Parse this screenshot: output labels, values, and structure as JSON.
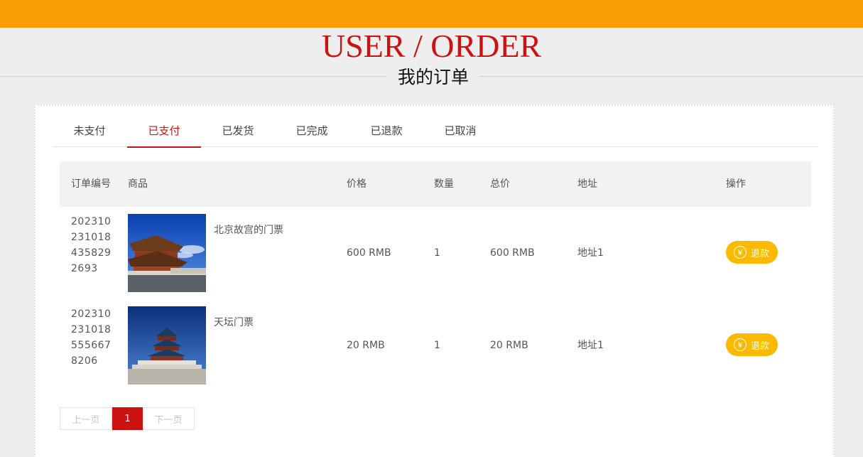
{
  "header": {
    "title_en": "USER / ORDER",
    "title_zh": "我的订单",
    "bar_color": "#fb9e03",
    "title_color": "#cc1111"
  },
  "tabs": [
    {
      "label": "未支付",
      "active": false
    },
    {
      "label": "已支付",
      "active": true
    },
    {
      "label": "已发货",
      "active": false
    },
    {
      "label": "已完成",
      "active": false
    },
    {
      "label": "已退款",
      "active": false
    },
    {
      "label": "已取消",
      "active": false
    }
  ],
  "table": {
    "headers": {
      "order_no": "订单编号",
      "product": "商品",
      "price": "价格",
      "quantity": "数量",
      "total": "总价",
      "address": "地址",
      "action": "操作"
    },
    "rows": [
      {
        "order_no": "2023102310184358292693",
        "product": "北京故宫的门票",
        "image_icon": "forbidden-city-photo",
        "price": "600 RMB",
        "quantity": "1",
        "total": "600 RMB",
        "address": "地址1",
        "action_label": "退款",
        "action_icon": "yen-icon"
      },
      {
        "order_no": "2023102310185556678206",
        "product": "天坛门票",
        "image_icon": "temple-of-heaven-photo",
        "price": "20 RMB",
        "quantity": "1",
        "total": "20 RMB",
        "address": "地址1",
        "action_label": "退款",
        "action_icon": "yen-icon"
      }
    ]
  },
  "pagination": {
    "prev_label": "上一页",
    "current": "1",
    "next_label": "下一页"
  },
  "colors": {
    "accent_red": "#cc1111",
    "refund_button": "#fbb900"
  }
}
